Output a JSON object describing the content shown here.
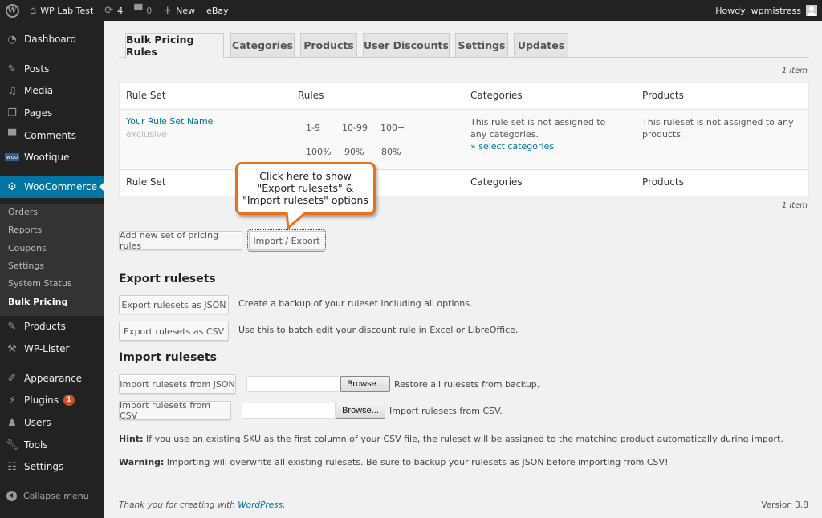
{
  "adminbar": {
    "site_name": "WP Lab Test",
    "updates_count": "4",
    "comments_count": "0",
    "new_label": "New",
    "ebay_label": "eBay",
    "howdy": "Howdy, wpmistress"
  },
  "sidebar": {
    "items": [
      {
        "label": "Dashboard",
        "icon": "dashboard-icon"
      },
      {
        "label": "Posts",
        "icon": "pin-icon"
      },
      {
        "label": "Media",
        "icon": "media-icon"
      },
      {
        "label": "Pages",
        "icon": "pages-icon"
      },
      {
        "label": "Comments",
        "icon": "comment-icon"
      },
      {
        "label": "Wootique",
        "icon": "woo-icon"
      },
      {
        "label": "WooCommerce",
        "icon": "gear-icon"
      },
      {
        "label": "Products",
        "icon": "pin-icon"
      },
      {
        "label": "WP-Lister",
        "icon": "hammer-icon"
      },
      {
        "label": "Appearance",
        "icon": "brush-icon"
      },
      {
        "label": "Plugins",
        "icon": "plug-icon",
        "badge": "1"
      },
      {
        "label": "Users",
        "icon": "user-icon"
      },
      {
        "label": "Tools",
        "icon": "wrench-icon"
      },
      {
        "label": "Settings",
        "icon": "sliders-icon"
      }
    ],
    "submenu": [
      "Orders",
      "Reports",
      "Coupons",
      "Settings",
      "System Status",
      "Bulk Pricing"
    ],
    "collapse_label": "Collapse menu",
    "accent": "#0074a2"
  },
  "tabs": [
    "Bulk Pricing Rules",
    "Categories",
    "Products",
    "User Discounts",
    "Settings",
    "Updates"
  ],
  "table": {
    "item_count": "1 item",
    "headers": [
      "Rule Set",
      "Rules",
      "Categories",
      "Products"
    ],
    "row": {
      "name": "Your Rule Set Name",
      "type": "exclusive",
      "ranges": [
        "1-9",
        "10-99",
        "100+"
      ],
      "percents": [
        "100%",
        "90%",
        "80%"
      ],
      "categories_text": "This rule set is not assigned to any categories.",
      "select_categories": "» select categories",
      "products_text": "This ruleset is not assigned to any products."
    }
  },
  "actions": {
    "add_new": "Add new set of pricing rules",
    "import_export": "Import / Export"
  },
  "callout": {
    "line1": "Click here to show",
    "line2": "\"Export rulesets\" &",
    "line3": "\"Import rulesets\" options",
    "border_color": "#e6731c"
  },
  "export": {
    "title": "Export rulesets",
    "json_button": "Export rulesets as JSON",
    "json_desc": "Create a backup of your ruleset including all options.",
    "csv_button": "Export rulesets as CSV",
    "csv_desc": "Use this to batch edit your discount rule in Excel or LibreOffice."
  },
  "import": {
    "title": "Import rulesets",
    "json_button": "Import rulesets from JSON",
    "json_file_value": "",
    "browse_label": "Browse...",
    "json_desc": "Restore all rulesets from backup.",
    "csv_button": "Import rulesets from CSV",
    "csv_file_value": "",
    "csv_desc": "Import rulesets from CSV."
  },
  "notes": {
    "hint_label": "Hint:",
    "hint_text": " If you use an existing SKU as the first column of your CSV file, the ruleset will be assigned to the matching product automatically during import.",
    "warning_label": "Warning:",
    "warning_text": " Importing will overwrite all existing rulesets. Be sure to backup your rulesets as JSON before importing from CSV!"
  },
  "footer": {
    "thanks_prefix": "Thank you for creating with ",
    "wordpress_link": "WordPress",
    "thanks_suffix": ".",
    "version": "Version 3.8"
  }
}
